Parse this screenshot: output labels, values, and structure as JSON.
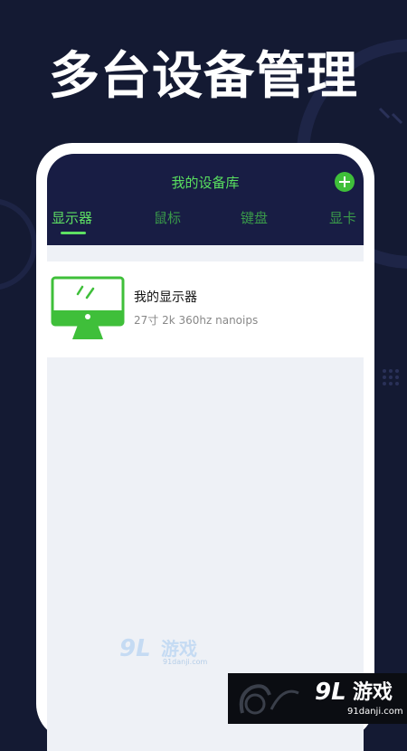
{
  "headline": "多台设备管理",
  "app": {
    "title": "我的设备库",
    "add_icon": "plus-circle-icon",
    "tabs": [
      {
        "label": "显示器",
        "active": true
      },
      {
        "label": "鼠标",
        "active": false
      },
      {
        "label": "键盘",
        "active": false
      },
      {
        "label": "显卡",
        "active": false
      }
    ]
  },
  "devices": [
    {
      "name": "我的显示器",
      "spec": "27寸 2k 360hz nanoips",
      "icon": "monitor-icon"
    }
  ],
  "watermark": {
    "mark": "9L",
    "name": "游戏",
    "site": "91danji.com"
  },
  "colors": {
    "background": "#141a33",
    "app_header": "#181d44",
    "accent_green": "#5ee063",
    "content_bg": "#eef1f6"
  }
}
